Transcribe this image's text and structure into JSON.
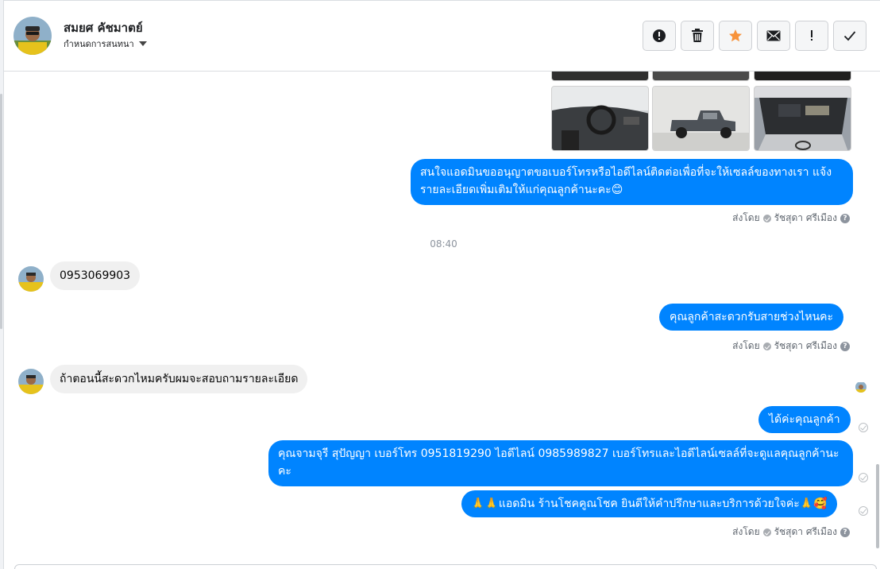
{
  "header": {
    "contact_name": "สมยศ คัชมาตย์",
    "conversation_menu_label": "กำหนดการสนทนา",
    "toolbar": {
      "spam_icon": "exclamation-circle-icon",
      "delete_icon": "trash-icon",
      "star_icon": "star-icon",
      "unread_icon": "envelope-icon",
      "follow_up_icon": "exclamation-icon",
      "done_icon": "checkmark-icon"
    }
  },
  "colors": {
    "outgoing_bubble": "#0084ff",
    "incoming_bubble": "#f0f0f0",
    "star": "#f7923a"
  },
  "messages": [
    {
      "direction": "out",
      "text": "สนใจแอดมินขออนุญาตขอเบอร์โทรหรือไอดีไลน์ติดต่อเพื่อที่จะให้เซลล์ของทางเรา แจ้งรายละเอียดเพิ่มเติมให้แก่คุณลูกค้านะคะ😊",
      "sent_by_label": "ส่งโดย",
      "sent_by_name": "รัชสุดา ศรีเมือง"
    },
    {
      "direction": "separator",
      "text": "08:40"
    },
    {
      "direction": "in",
      "text": "0953069903"
    },
    {
      "direction": "out",
      "text": "คุณลูกค้าสะดวกรับสายช่วงไหนคะ",
      "sent_by_label": "ส่งโดย",
      "sent_by_name": "รัชสุดา ศรีเมือง"
    },
    {
      "direction": "in",
      "text": "ถ้าตอนนี้สะดวกไหมครับผมจะสอบถามรายละเอียด"
    },
    {
      "direction": "out",
      "text": "ได้ค่ะคุณลูกค้า"
    },
    {
      "direction": "out",
      "text": "คุณจามจุรี สุปัญญา เบอร์โทร 0951819290  ไอดีไลน์ 0985989827   เบอร์โทรและไอดีไลน์เซลล์ที่จะดูแลคุณลูกค้านะคะ"
    },
    {
      "direction": "out",
      "text": "🙏🙏แอดมิน ร้านโชคคูณโชค ยินดีให้คำปรึกษาและบริการด้วยใจค่ะ🙏🥰",
      "sent_by_label": "ส่งโดย",
      "sent_by_name": "รัชสุดา ศรีเมือง"
    }
  ]
}
